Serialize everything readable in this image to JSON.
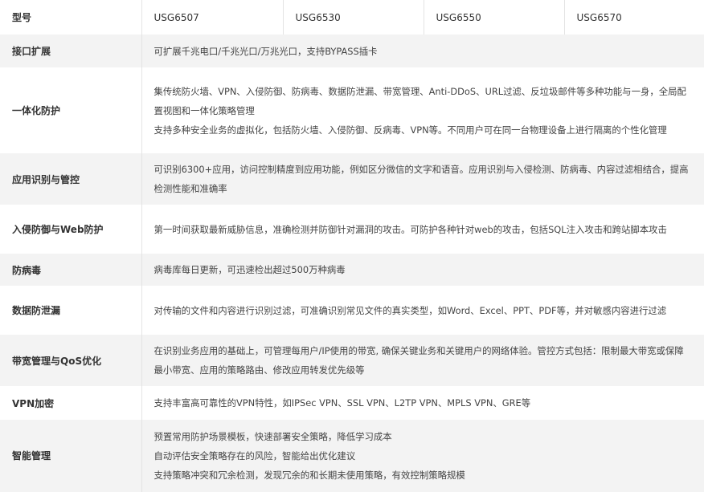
{
  "header": {
    "label": "型号",
    "models": [
      "USG6507",
      "USG6530",
      "USG6550",
      "USG6570"
    ]
  },
  "rows": [
    {
      "label": "接口扩展",
      "lines": [
        "可扩展千兆电口/千兆光口/万兆光口，支持BYPASS插卡"
      ]
    },
    {
      "label": "一体化防护",
      "lines": [
        "集传统防火墙、VPN、入侵防御、防病毒、数据防泄漏、带宽管理、Anti-DDoS、URL过滤、反垃圾邮件等多种功能与一身，全局配置视图和一体化策略管理",
        "支持多种安全业务的虚拟化，包括防火墙、入侵防御、反病毒、VPN等。不同用户可在同一台物理设备上进行隔离的个性化管理"
      ]
    },
    {
      "label": "应用识别与管控",
      "lines": [
        "可识别6300+应用，访问控制精度到应用功能，例如区分微信的文字和语音。应用识别与入侵检测、防病毒、内容过滤相结合，提高检测性能和准确率"
      ]
    },
    {
      "label": "入侵防御与Web防护",
      "lines": [
        "第一时间获取最新威胁信息，准确检测并防御针对漏洞的攻击。可防护各种针对web的攻击，包括SQL注入攻击和跨站脚本攻击"
      ]
    },
    {
      "label": "防病毒",
      "lines": [
        "病毒库每日更新，可迅速检出超过500万种病毒"
      ]
    },
    {
      "label": "数据防泄漏",
      "lines": [
        "对传输的文件和内容进行识别过滤，可准确识别常见文件的真实类型，如Word、Excel、PPT、PDF等，并对敏感内容进行过滤"
      ]
    },
    {
      "label": "带宽管理与QoS优化",
      "lines": [
        "在识别业务应用的基础上，可管理每用户/IP使用的带宽, 确保关键业务和关键用户的网络体验。管控方式包括：限制最大带宽或保障最小带宽、应用的策略路由、修改应用转发优先级等"
      ]
    },
    {
      "label": "VPN加密",
      "lines": [
        "支持丰富高可靠性的VPN特性，如IPSec VPN、SSL VPN、L2TP VPN、MPLS VPN、GRE等"
      ]
    },
    {
      "label": "智能管理",
      "lines": [
        "预置常用防护场景模板，快速部署安全策略，降低学习成本",
        "自动评估安全策略存在的风险，智能给出优化建议",
        "支持策略冲突和冗余检测，发现冗余的和长期未使用策略，有效控制策略规模"
      ]
    }
  ]
}
